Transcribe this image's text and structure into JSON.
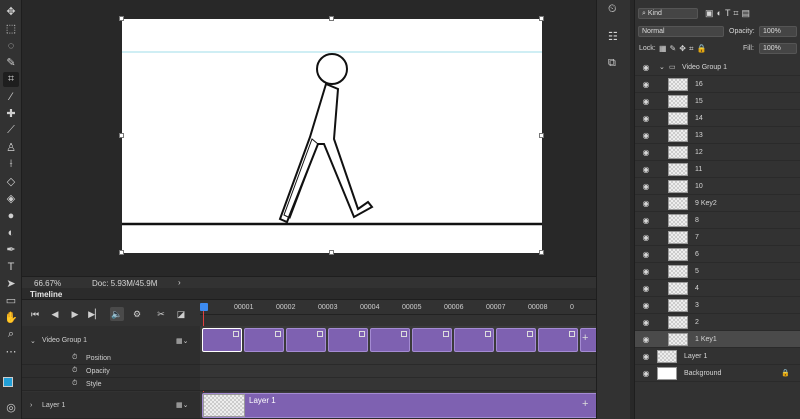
{
  "status": {
    "zoom": "66.67%",
    "doc": "Doc: 5.93M/45.9M"
  },
  "timeline": {
    "title": "Timeline",
    "ticks": [
      "00001",
      "00002",
      "00003",
      "00004",
      "00005",
      "00006",
      "00007",
      "00008",
      "0"
    ],
    "tracks": [
      {
        "label": "Video Group 1"
      },
      {
        "label": "Position"
      },
      {
        "label": "Opacity"
      },
      {
        "label": "Style"
      },
      {
        "label": "Layer 1"
      }
    ],
    "layer1_clip_label": "Layer 1",
    "add": "+"
  },
  "layers": {
    "filter_kind": "Kind",
    "blend_mode": "Normal",
    "opacity_label": "Opacity:",
    "opacity_value": "100%",
    "lock_label": "Lock:",
    "fill_label": "Fill:",
    "fill_value": "100%",
    "group_name": "Video Group 1",
    "frames": [
      "16",
      "15",
      "14",
      "13",
      "12",
      "11",
      "10",
      "9 Key2",
      "8",
      "7",
      "6",
      "5",
      "4",
      "3",
      "2",
      "1 Key1"
    ],
    "layer1": "Layer 1",
    "background": "Background"
  },
  "colors": {
    "accent_purple": "#7e61b1",
    "foreground": "#22a0d8",
    "background": "#ffffff"
  }
}
